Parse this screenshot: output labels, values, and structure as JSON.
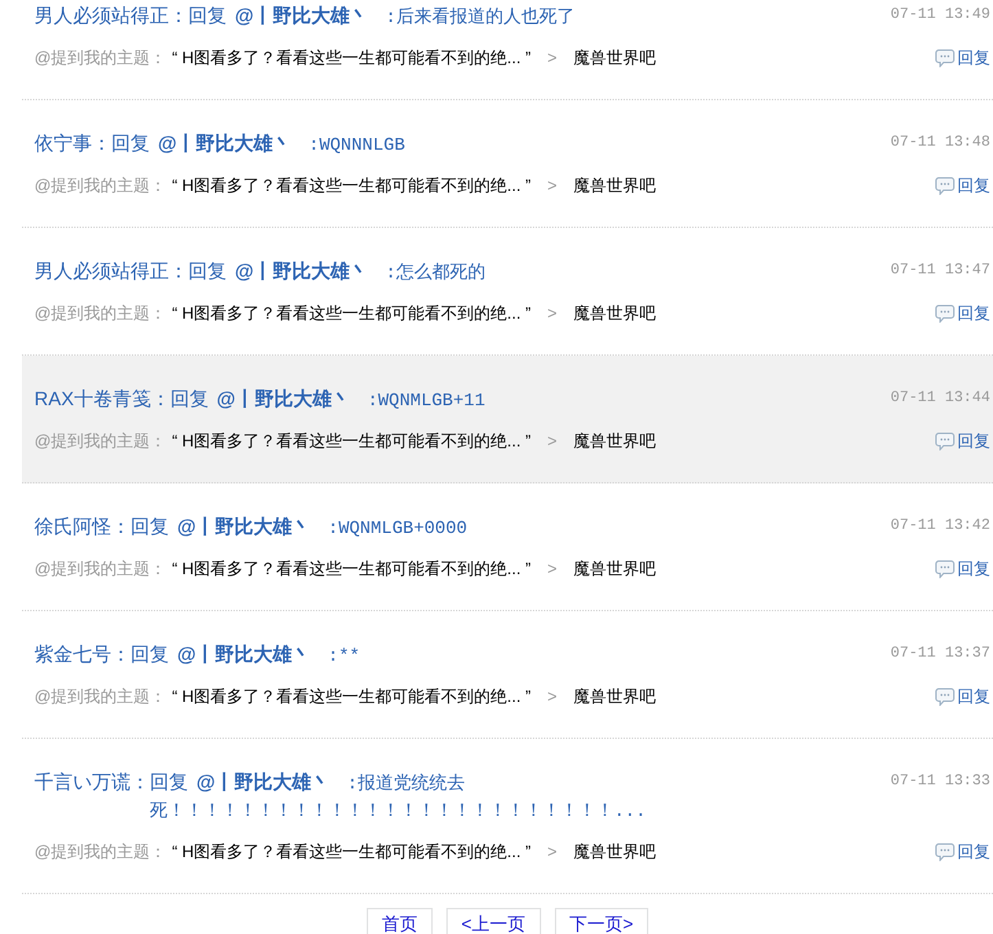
{
  "messages": [
    {
      "author": "男人必须站得正：",
      "reply_label": "回复",
      "mention": "@丨野比大雄丶",
      "content": ":后来看报道的人也死了",
      "time": "07-11 13:49",
      "topic_label": "@提到我的主题：",
      "topic": "“ H图看多了？看看这些一生都可能看不到的绝... ”",
      "separator": ">",
      "forum": "魔兽世界吧",
      "reply_button": "回复",
      "hovered": false
    },
    {
      "author": "依宁事：",
      "reply_label": "回复",
      "mention": "@丨野比大雄丶",
      "content": ":WQNNNLGB",
      "time": "07-11 13:48",
      "topic_label": "@提到我的主题：",
      "topic": "“ H图看多了？看看这些一生都可能看不到的绝... ”",
      "separator": ">",
      "forum": "魔兽世界吧",
      "reply_button": "回复",
      "hovered": false
    },
    {
      "author": "男人必须站得正：",
      "reply_label": "回复",
      "mention": "@丨野比大雄丶",
      "content": ":怎么都死的",
      "time": "07-11 13:47",
      "topic_label": "@提到我的主题：",
      "topic": "“ H图看多了？看看这些一生都可能看不到的绝... ”",
      "separator": ">",
      "forum": "魔兽世界吧",
      "reply_button": "回复",
      "hovered": false
    },
    {
      "author": "RAX十卷青笺：",
      "reply_label": "回复",
      "mention": "@丨野比大雄丶",
      "content": ":WQNMLGB+11",
      "time": "07-11 13:44",
      "topic_label": "@提到我的主题：",
      "topic": "“ H图看多了？看看这些一生都可能看不到的绝... ”",
      "separator": ">",
      "forum": "魔兽世界吧",
      "reply_button": "回复",
      "hovered": true
    },
    {
      "author": "徐氏阿怪：",
      "reply_label": "回复",
      "mention": "@丨野比大雄丶",
      "content": ":WQNMLGB+0000",
      "time": "07-11 13:42",
      "topic_label": "@提到我的主题：",
      "topic": "“ H图看多了？看看这些一生都可能看不到的绝... ”",
      "separator": ">",
      "forum": "魔兽世界吧",
      "reply_button": "回复",
      "hovered": false
    },
    {
      "author": "紫金七号：",
      "reply_label": "回复",
      "mention": "@丨野比大雄丶",
      "content": ":**",
      "time": "07-11 13:37",
      "topic_label": "@提到我的主题：",
      "topic": "“ H图看多了？看看这些一生都可能看不到的绝... ”",
      "separator": ">",
      "forum": "魔兽世界吧",
      "reply_button": "回复",
      "hovered": false
    },
    {
      "author": "千言い万谎：",
      "reply_label": "回复",
      "mention": "@丨野比大雄丶",
      "content": ":报道党统统去死！！！！！！！！！！！！！！！！！！！！！！！！！...",
      "time": "07-11 13:33",
      "topic_label": "@提到我的主题：",
      "topic": "“ H图看多了？看看这些一生都可能看不到的绝... ”",
      "separator": ">",
      "forum": "魔兽世界吧",
      "reply_button": "回复",
      "hovered": false
    }
  ],
  "pagination": [
    "首页",
    "<上一页",
    "下一页>"
  ]
}
